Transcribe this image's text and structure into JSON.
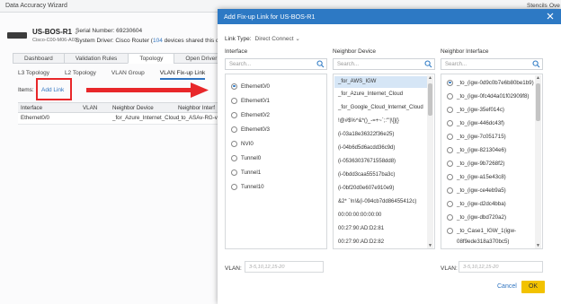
{
  "window": {
    "title": "Data Accuracy Wizard",
    "right_menu": [
      "Stencils",
      "Ove"
    ]
  },
  "device": {
    "name": "US-BOS-R1",
    "model": "Cisco-C00-M06-A03",
    "serial": "Serial Number: 69230604",
    "driver_prefix": "System Driver: Cisco Router (",
    "driver_count": "104",
    "driver_suffix": " devices shared this drive"
  },
  "tabs_top": [
    "Dashboard",
    "Validation Rules",
    "Topology",
    "Open Driver"
  ],
  "tabs_sub": [
    "L3 Topology",
    "L2 Topology",
    "VLAN Group",
    "VLAN Fix-up Link"
  ],
  "items": {
    "label": "Items:",
    "add_link": "Add Link"
  },
  "bg_table": {
    "headers": [
      "Interface",
      "VLAN",
      "Neighbor Device",
      "Neighbor Interf"
    ],
    "rows": [
      [
        "Ethernet0/0",
        "",
        "_for_Azure_Internet_Cloud",
        "_to_ASAv-RG-vn"
      ]
    ]
  },
  "dialog": {
    "title": "Add Fix-up Link for US-BOS-R1",
    "link_type_label": "Link Type:",
    "link_type_value": "Direct Connect",
    "columns": {
      "interface": "Interface",
      "neighbor_device": "Neighbor Device",
      "neighbor_interface": "Neighbor Interface"
    },
    "search_placeholder": "Search...",
    "interfaces": [
      "Ethernet0/0",
      "Ethernet0/1",
      "Ethernet0/2",
      "Ethernet0/3",
      "NVI0",
      "Tunnel0",
      "Tunnel1",
      "Tunnel10"
    ],
    "neighbor_devices": [
      "_for_AWS_IGW",
      "_for_Azure_Internet_Cloud",
      "_for_Google_Cloud_Internet_Cloud",
      "!@#$%^&*()_-=+~`;:'\"|\\[]{}",
      "(i-03a18e36322f36e25)",
      "(i-04b6d5d6acdd36c9d)",
      "(i-05363037671558dd8)",
      "(i-0bdd3caa55517ba3c)",
      "(i-0bf20d0e607e910e9)",
      "&2* `!n!&(i-094cb7dd86455412c)",
      "00:00:00:00:00:00",
      "00:27:90:AD:D2:81",
      "00:27:90:AD:D2:82"
    ],
    "neighbor_interfaces": [
      "_to_(igw-0d9c0b7e6b80be1b9)",
      "_to_(igw-0fc4d4a01f02909f8)",
      "_to_(igw-35ef014c)",
      "_to_(igw-446dc43f)",
      "_to_(igw-7c051715)",
      "_to_(igw-821304e6)",
      "_to_(igw-9b7268f2)",
      "_to_(igw-a15e43c8)",
      "_to_(igw-ce4eb9a5)",
      "_to_(igw-d2dc4bba)",
      "_to_(igw-dbd720a2)",
      "_to_Case1_IGW_1(igw-",
      "08f9ede318a370bc5)"
    ],
    "vlan_label": "VLAN:",
    "vlan_placeholder": "3-5,10,12,15-20",
    "cancel_label": "Cancel",
    "ok_label": "OK"
  },
  "colors": {
    "accent": "#2d79c4",
    "ok_button": "#f2c200",
    "highlight": "#e8272a",
    "selected_row": "#d6e6f6"
  }
}
